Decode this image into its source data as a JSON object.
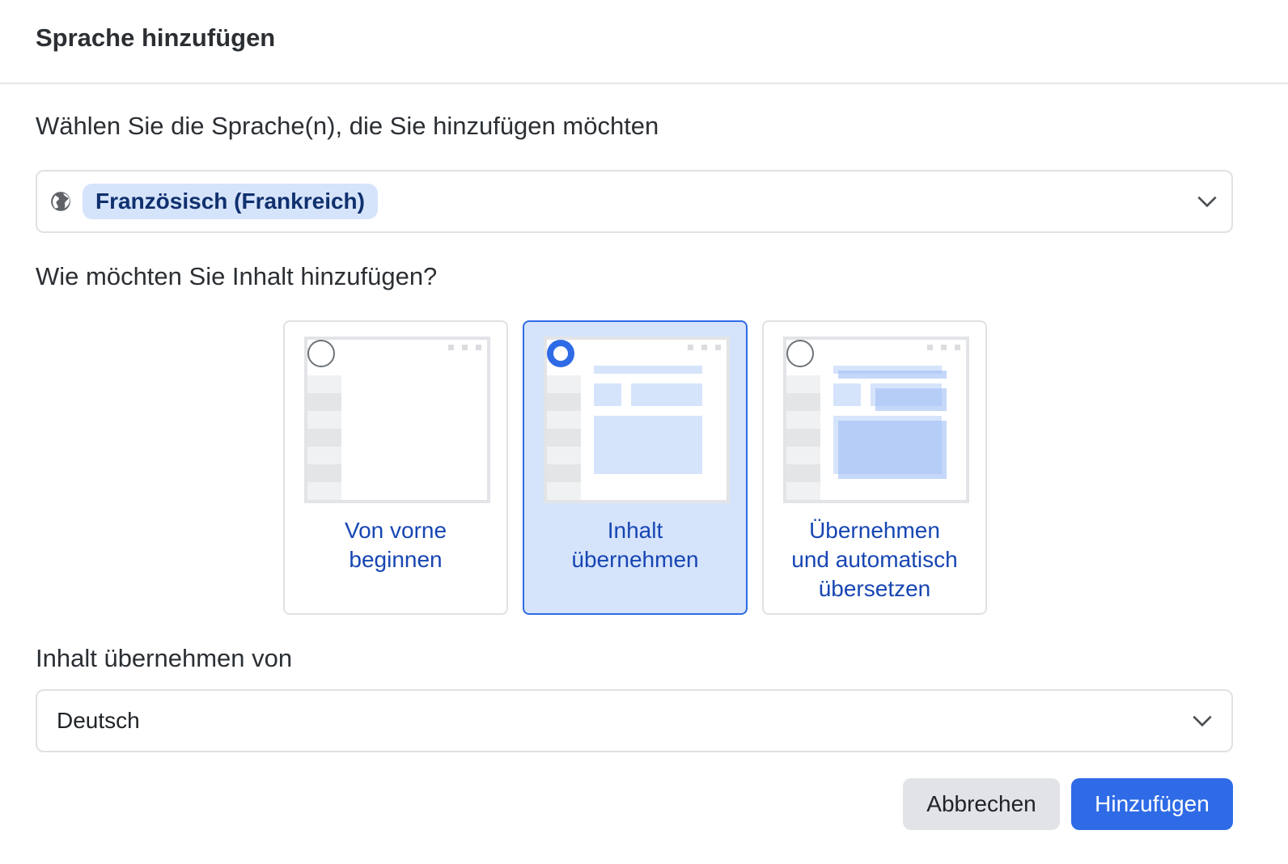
{
  "dialog": {
    "title": "Sprache hinzufügen"
  },
  "language_select": {
    "label": "Wählen Sie die Sprache(n), die Sie hinzufügen möchten",
    "selected_chip": "Französisch (Frankreich)",
    "icon": "globe-icon"
  },
  "content_method": {
    "label": "Wie möchten Sie Inhalt hinzufügen?",
    "options": [
      {
        "label": "Von vorne\nbeginnen",
        "selected": false
      },
      {
        "label": "Inhalt\nübernehmen",
        "selected": true
      },
      {
        "label": "Übernehmen\nund automatisch\nübersetzen",
        "selected": false
      }
    ]
  },
  "source_select": {
    "label": "Inhalt übernehmen von",
    "value": "Deutsch"
  },
  "footer": {
    "cancel_label": "Abbrechen",
    "add_label": "Hinzufügen"
  },
  "colors": {
    "accent": "#2f6be6",
    "selected_bg": "#d6e4fb",
    "option_text": "#1746b3"
  }
}
